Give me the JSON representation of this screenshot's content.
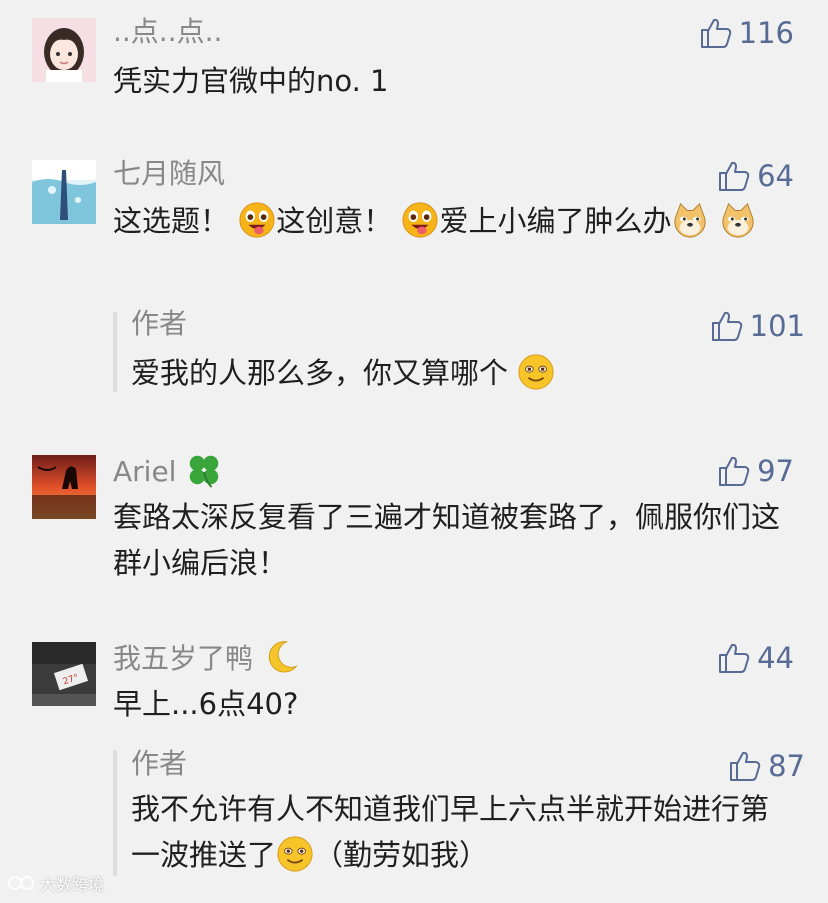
{
  "colors": {
    "like": "#576b95",
    "name": "#888888",
    "text": "#1f1f1f",
    "background": "#f1f1f1"
  },
  "comments": [
    {
      "name": "..点..点..",
      "text": "凭实力官微中的no. 1",
      "likes": "116",
      "avatar": "girl-avatar"
    },
    {
      "name": "七月随风",
      "text_parts": [
        "这选题！",
        "这创意！",
        "爱上小编了肿么办"
      ],
      "likes": "64",
      "avatar": "water-avatar",
      "reply": {
        "name": "作者",
        "text": "爱我的人那么多，你又算哪个",
        "likes": "101"
      }
    },
    {
      "name": "Ariel",
      "name_icon": "clover-icon",
      "text": "套路太深反复看了三遍才知道被套路了，佩服你们这群小编后浪！",
      "likes": "97",
      "avatar": "sunset-avatar"
    },
    {
      "name": "我五岁了鸭",
      "name_icon": "moon-icon",
      "text": "早上...6点40?",
      "likes": "44",
      "avatar": "street-avatar",
      "reply": {
        "name": "作者",
        "text_main": "我不允许有人不知道我们早上六点半就开始进行第一波推送了",
        "text_tail": "（勤劳如我）",
        "likes": "87"
      }
    }
  ],
  "watermark": "大数跨境"
}
